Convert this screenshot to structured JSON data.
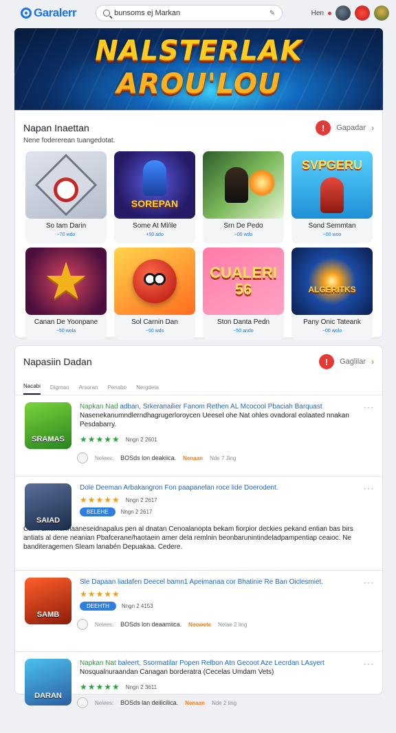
{
  "header": {
    "logo": "Garalerr",
    "search_value": "bunsoms ej Markan",
    "link": "Hen"
  },
  "banner": {
    "line1": "NALSTERLAK",
    "line2": "AROU'LOU"
  },
  "featured": {
    "title": "Napan Inaettan",
    "subtitle": "Nene fodererean tuangedotat.",
    "badge": "!",
    "link": "Gapadar",
    "items": [
      {
        "name": "So tam Darin",
        "count": "~70 wdo",
        "art": "",
        "icon": "shuriken-icon"
      },
      {
        "name": "Some At Ml/ile",
        "count": "+50 ado",
        "art": "SOREPAN",
        "icon": "character-icon"
      },
      {
        "name": "Srn De Pedo",
        "count": "~00 wdo",
        "art": "",
        "icon": "fighter-icon"
      },
      {
        "name": "Sond Semmtan",
        "count": "~00 woo",
        "art": "SVPGERU",
        "icon": "party-icon"
      },
      {
        "name": "Canan De Yoonpane",
        "count": "~50 wola",
        "art": "",
        "icon": "star-icon"
      },
      {
        "name": "Sol Carnin Dan",
        "count": "~50 wds",
        "art": "",
        "icon": "ball-icon"
      },
      {
        "name": "Ston Danta Pedn",
        "count": "~50 ando",
        "art": "CUALERI 56",
        "icon": "gamepad-icon"
      },
      {
        "name": "Pany Onic Tateank",
        "count": "~00 wolo",
        "art": "ALGERITKS",
        "icon": "explosion-icon"
      }
    ]
  },
  "popular": {
    "title": "Napasiin Dadan",
    "badge": "!",
    "link": "Gaglilar",
    "tabs": [
      "Nacabi",
      "Digmao",
      "Arsoran",
      "Penabo",
      "Nergdeta"
    ],
    "items": [
      {
        "title_green": "Napkan Nad",
        "title": "adban, Srkeranailier Fanom Rethen AL Mcocool Pbaciah Barquast",
        "desc": "Nasenekanumndlerndhagrugerloroycen Ueesel ohe Nat ohles ovadoral eolaated nnakan Pesdabarry.",
        "stars": "★★★★★",
        "date": "Nngn 2 2601",
        "foot_label": "Nelees:",
        "foot_text": "BOSds lon deakiica.",
        "tag": "Nenaan",
        "meta": "Nde 7 Jing",
        "icon_text": "SRAMAS"
      },
      {
        "title": "Dole Deeman Arbakangron Fon paapanelan roce lide Doerodent.",
        "stars": "★★★★★",
        "date": "Nngn 2 2617",
        "pill": "BELEHE",
        "para": "Caml blkemsrmaaneseidnapalus pen al dnatan Cenoalanopta bekam fiorpior deckies pekand entian bas birs antiats al dene neanian Pbafcerane/haotaein amer dela remlnin beonbarunintindeladpampentiap ceaioc. Ne banditeragemen Sleam lanabén Depuakaa. Cedere.",
        "icon_text": "SAIAD"
      },
      {
        "title": "Sle Dapaan liadafen Deecel bamn1 Apeimanaa cor Bhatinie Re Ban Oiclesmiet.",
        "stars": "★★★★★",
        "date": "Nngn 2 4153",
        "pill": "DEEHTH",
        "foot_label": "Nelees:",
        "foot_text": "BOSds lon deaamiica.",
        "tag": "Neowete",
        "meta": "Nelae 2 ling",
        "icon_text": "SAMB"
      },
      {
        "title_green": "Napkan Nat",
        "title": "baleert, Ssormatilar Popen Relbon Atn Gecoot Aze Lecrdan LAsyert",
        "desc": "Nosqualnuraandan Canagan borderatra (Cecelas Umdam Vets)",
        "stars": "★★★★★",
        "date": "Nngn 2 3611",
        "foot_label": "Nelees:",
        "foot_text": "BOSds lan deilicilica.",
        "tag": "Nenaan",
        "meta": "Nde 2 ling",
        "icon_text": "DARAN"
      }
    ]
  }
}
